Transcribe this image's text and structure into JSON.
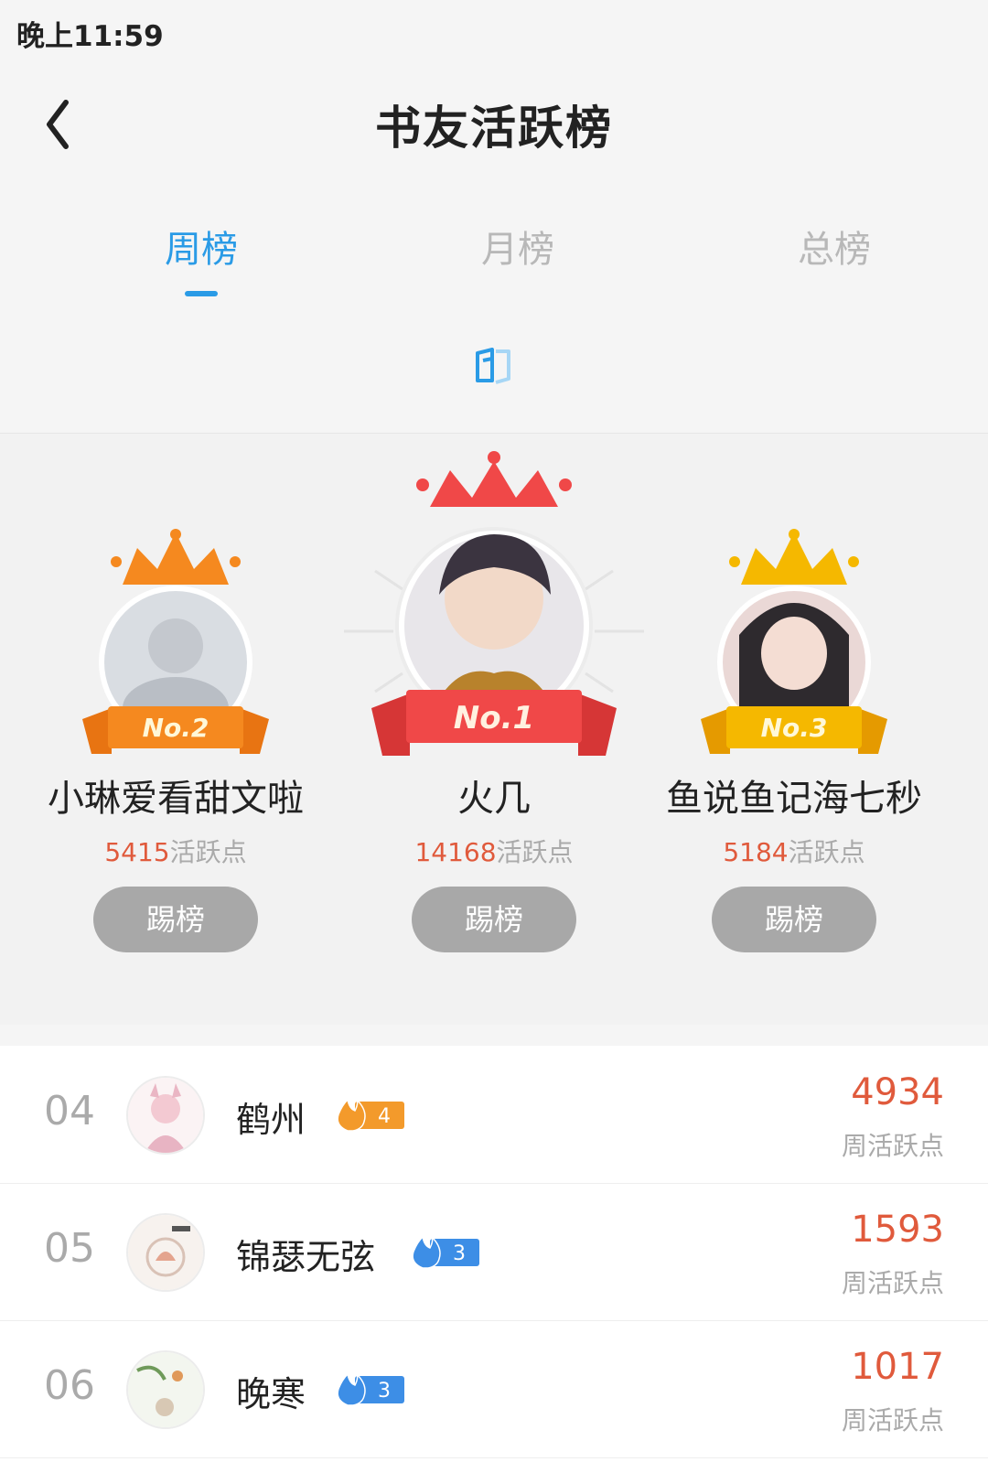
{
  "status_bar": {
    "time": "晚上11:59"
  },
  "header": {
    "title": "书友活跃榜"
  },
  "tabs": [
    {
      "label": "周榜",
      "active": true
    },
    {
      "label": "月榜",
      "active": false
    },
    {
      "label": "总榜",
      "active": false
    }
  ],
  "colors": {
    "accent": "#2a9be6",
    "points": "#e05a3c",
    "crown_gold": "#f5b800",
    "crown_orange": "#f5891f",
    "crown_red": "#f04848"
  },
  "podium": [
    {
      "rank_label": "No.2",
      "name": "小琳爱看甜文啦",
      "points": "5415",
      "points_unit": "活跃点",
      "button": "踢榜"
    },
    {
      "rank_label": "No.1",
      "name": "火几",
      "points": "14168",
      "points_unit": "活跃点",
      "button": "踢榜"
    },
    {
      "rank_label": "No.3",
      "name": "鱼说鱼记海七秒",
      "points": "5184",
      "points_unit": "活跃点",
      "button": "踢榜"
    }
  ],
  "list": [
    {
      "rank": "04",
      "name": "鹤州",
      "level": "4",
      "level_color": "orange",
      "score": "4934",
      "score_label": "周活跃点"
    },
    {
      "rank": "05",
      "name": "锦瑟无弦",
      "level": "3",
      "level_color": "blue",
      "score": "1593",
      "score_label": "周活跃点"
    },
    {
      "rank": "06",
      "name": "晚寒",
      "level": "3",
      "level_color": "blue",
      "score": "1017",
      "score_label": "周活跃点"
    }
  ]
}
